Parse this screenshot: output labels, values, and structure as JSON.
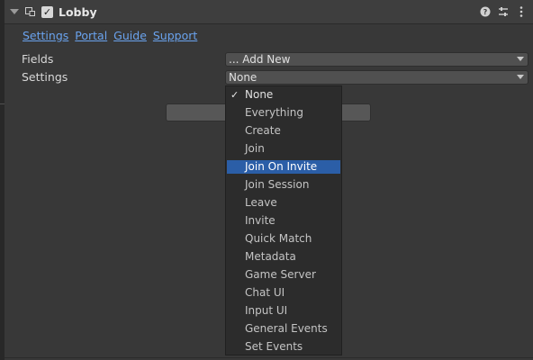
{
  "header": {
    "title": "Lobby",
    "enabled": true,
    "icons": [
      "foldout-arrow-icon",
      "component-icon",
      "help-icon",
      "preset-icon",
      "more-options-icon"
    ]
  },
  "links": [
    "Settings",
    "Portal",
    "Guide",
    "Support"
  ],
  "fields": {
    "label": "Fields",
    "value": "... Add New"
  },
  "settings": {
    "label": "Settings",
    "value": "None"
  },
  "menu": {
    "checkmark": "✓",
    "items": [
      {
        "label": "None",
        "checked": true
      },
      {
        "label": "Everything"
      },
      {
        "label": "Create"
      },
      {
        "label": "Join"
      },
      {
        "label": "Join On Invite",
        "highlighted": true
      },
      {
        "label": "Join Session"
      },
      {
        "label": "Leave"
      },
      {
        "label": "Invite"
      },
      {
        "label": "Quick Match"
      },
      {
        "label": "Metadata"
      },
      {
        "label": "Game Server"
      },
      {
        "label": "Chat UI"
      },
      {
        "label": "Input UI"
      },
      {
        "label": "General Events"
      },
      {
        "label": "Set Events"
      }
    ]
  },
  "colors": {
    "highlight": "#2b5ea7",
    "link": "#6aa3ee",
    "background": "#383838"
  }
}
